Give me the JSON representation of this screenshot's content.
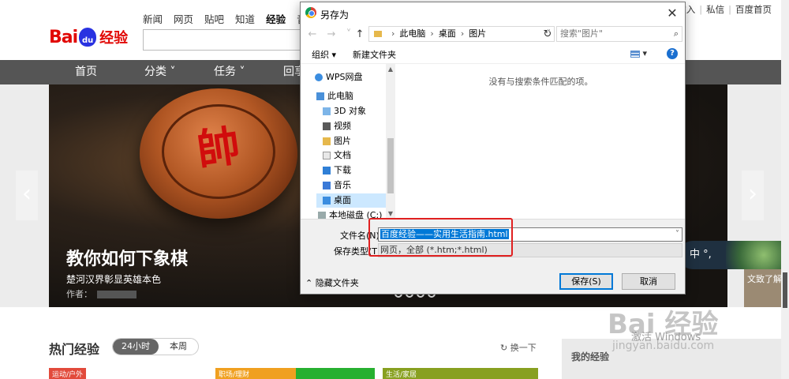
{
  "page": {
    "logo_text": "Bai",
    "logo_paw": "du",
    "logo_suffix": "经验",
    "topnav": [
      "新闻",
      "网页",
      "贴吧",
      "知道",
      "经验",
      "音乐"
    ],
    "toplinks": [
      "的收入",
      "私信",
      "百度首页"
    ],
    "mainnav": [
      "首页",
      "分类 ˅",
      "任务 ˅",
      "回享"
    ],
    "banner": {
      "title": "教你如何下象棋",
      "subtitle": "楚河汉界彰显英雄本色",
      "author_label": "作者：",
      "chess_char": "帥"
    },
    "right_widget_text": "中 °,",
    "side_img_text": "文致了解",
    "hot_title": "热门经验",
    "pill_on": "24小时",
    "pill_off": "本周",
    "swap": "换一下",
    "card_tags": [
      "运动/户外",
      "职场/理财",
      "生活/家居"
    ],
    "my_exp": "我的经验",
    "watermark": "Bai 经验",
    "watermark_url": "jingyan.baidu.com",
    "win_activate": "激活 Windows"
  },
  "dialog": {
    "title": "另存为",
    "close_glyph": "✕",
    "back_glyph": "←",
    "forward_glyph": "→",
    "up_glyph": "↑",
    "path": [
      "此电脑",
      "桌面",
      "图片"
    ],
    "refresh_glyph": "↻",
    "search_placeholder": "搜索\"图片\"",
    "toolbar": {
      "organize": "组织 ▾",
      "new_folder": "新建文件夹",
      "view": "▾",
      "help": "?"
    },
    "tree": [
      {
        "label": "WPS网盘",
        "icon": "cloud-icon"
      },
      {
        "label": "此电脑",
        "icon": "computer-icon"
      },
      {
        "label": "3D 对象",
        "icon": "cube-icon"
      },
      {
        "label": "视频",
        "icon": "video-icon"
      },
      {
        "label": "图片",
        "icon": "picture-icon"
      },
      {
        "label": "文档",
        "icon": "document-icon"
      },
      {
        "label": "下载",
        "icon": "download-icon"
      },
      {
        "label": "音乐",
        "icon": "music-icon"
      },
      {
        "label": "桌面",
        "icon": "desktop-icon"
      },
      {
        "label": "本地磁盘 (C:)",
        "icon": "drive-icon"
      }
    ],
    "empty_message": "没有与搜索条件匹配的项。",
    "filename_label": "文件名(N):",
    "filename_value": "百度经验——实用生活指南.html",
    "filetype_label": "保存类型(T):",
    "filetype_value": "网页，全部 (*.htm;*.html)",
    "hide_folders": "隐藏文件夹",
    "save_button": "保存(S)",
    "cancel_button": "取消"
  },
  "colors": {
    "baidu_red": "#e10602",
    "baidu_blue": "#2932e1",
    "highlight": "#e02020",
    "selection": "#0078d7"
  }
}
